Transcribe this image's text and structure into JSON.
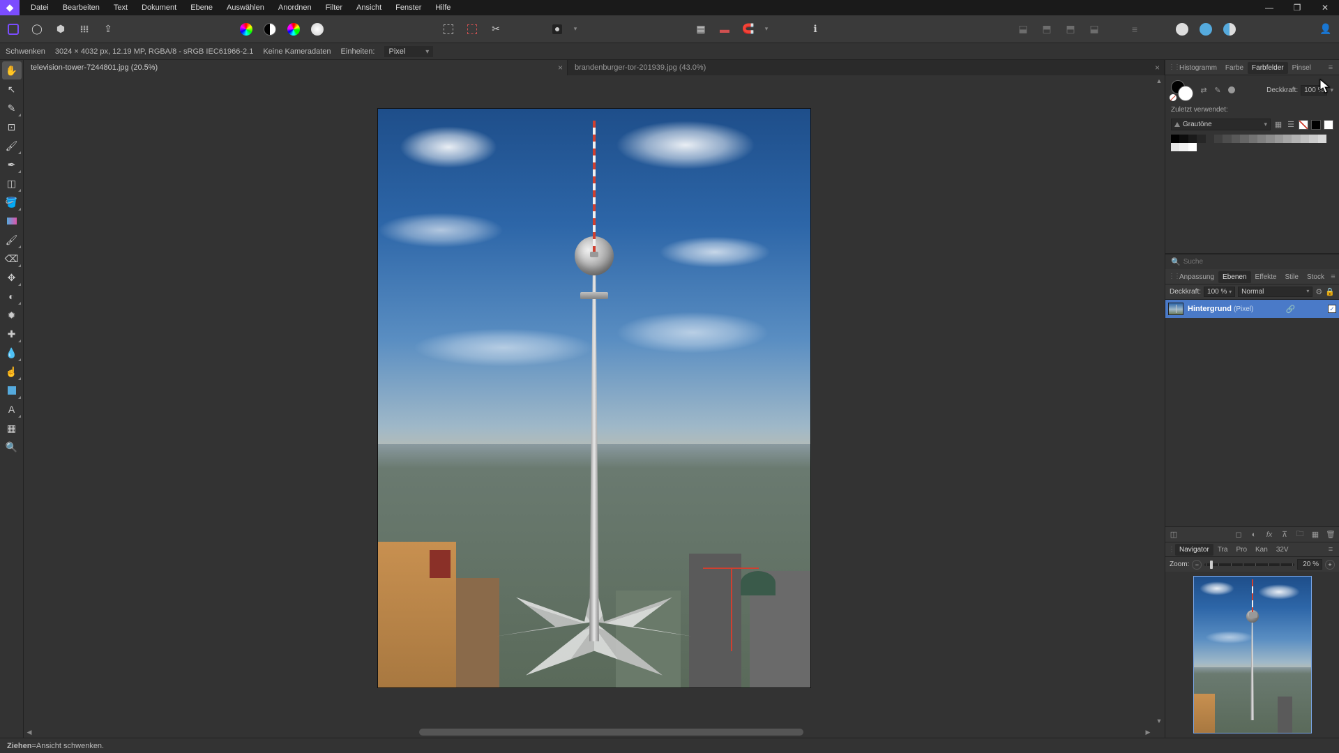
{
  "menu": [
    "Datei",
    "Bearbeiten",
    "Text",
    "Dokument",
    "Ebene",
    "Auswählen",
    "Anordnen",
    "Filter",
    "Ansicht",
    "Fenster",
    "Hilfe"
  ],
  "context": {
    "tool": "Schwenken",
    "dims": "3024 × 4032 px, 12.19 MP, RGBA/8 - sRGB IEC61966-2.1",
    "camera": "Keine Kameradaten",
    "units_label": "Einheiten:",
    "units_value": "Pixel"
  },
  "tabs": [
    {
      "label": "television-tower-7244801.jpg (20.5%)",
      "active": true
    },
    {
      "label": "brandenburger-tor-201939.jpg (43.0%)",
      "active": false
    }
  ],
  "color_panel": {
    "tabs": [
      "Histogramm",
      "Farbe",
      "Farbfelder",
      "Pinsel"
    ],
    "active_tab": "Farbfelder",
    "opacity_label": "Deckkraft:",
    "opacity_value": "100 %",
    "recent_label": "Zuletzt verwendet:",
    "palette": "Grautöne",
    "swatches": [
      "#000000",
      "#0d0d0d",
      "#1a1a1a",
      "#262626",
      "#333333",
      "#404040",
      "#4d4d4d",
      "#595959",
      "#666666",
      "#737373",
      "#808080",
      "#8c8c8c",
      "#999999",
      "#a6a6a6",
      "#b3b3b3",
      "#bfbfbf",
      "#cccccc",
      "#d9d9d9",
      "#e6e6e6",
      "#f2f2f2",
      "#ffffff"
    ],
    "search_placeholder": "Suche"
  },
  "layers_panel": {
    "tabs": [
      "Anpassung",
      "Ebenen",
      "Effekte",
      "Stile",
      "Stock"
    ],
    "active_tab": "Ebenen",
    "opacity_label": "Deckkraft:",
    "opacity_value": "100 %",
    "blend_mode": "Normal",
    "layer_name": "Hintergrund",
    "layer_type": "(Pixel)"
  },
  "nav_panel": {
    "tabs": [
      "Navigator",
      "Tra",
      "Pro",
      "Kan",
      "32V"
    ],
    "active_tab": "Navigator",
    "zoom_label": "Zoom:",
    "zoom_value": "20 %"
  },
  "status": {
    "action": "Ziehen",
    "sep": " = ",
    "desc": "Ansicht schwenken."
  }
}
